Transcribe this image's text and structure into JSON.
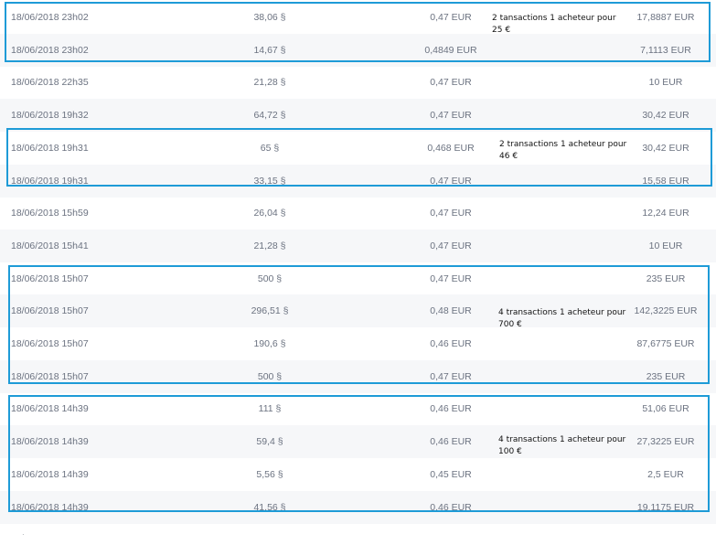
{
  "table": {
    "rows": [
      {
        "date": "18/06/2018 23h02",
        "amount": "38,06 §",
        "price": "0,47 EUR",
        "total": "17,8887 EUR"
      },
      {
        "date": "18/06/2018 23h02",
        "amount": "14,67 §",
        "price": "0,4849 EUR",
        "total": "7,1113 EUR"
      },
      {
        "date": "18/06/2018 22h35",
        "amount": "21,28 §",
        "price": "0,47 EUR",
        "total": "10 EUR"
      },
      {
        "date": "18/06/2018 19h32",
        "amount": "64,72 §",
        "price": "0,47 EUR",
        "total": "30,42 EUR"
      },
      {
        "date": "18/06/2018 19h31",
        "amount": "65 §",
        "price": "0,468 EUR",
        "total": "30,42 EUR"
      },
      {
        "date": "18/06/2018 19h31",
        "amount": "33,15 §",
        "price": "0,47 EUR",
        "total": "15,58 EUR"
      },
      {
        "date": "18/06/2018 15h59",
        "amount": "26,04 §",
        "price": "0,47 EUR",
        "total": "12,24 EUR"
      },
      {
        "date": "18/06/2018 15h41",
        "amount": "21,28 §",
        "price": "0,47 EUR",
        "total": "10 EUR"
      },
      {
        "date": "18/06/2018 15h07",
        "amount": "500 §",
        "price": "0,47 EUR",
        "total": "235 EUR"
      },
      {
        "date": "18/06/2018 15h07",
        "amount": "296,51 §",
        "price": "0,48 EUR",
        "total": "142,3225 EUR"
      },
      {
        "date": "18/06/2018 15h07",
        "amount": "190,6 §",
        "price": "0,46 EUR",
        "total": "87,6775 EUR"
      },
      {
        "date": "18/06/2018 15h07",
        "amount": "500 §",
        "price": "0,47 EUR",
        "total": "235 EUR"
      },
      {
        "date": "18/06/2018 14h39",
        "amount": "111 §",
        "price": "0,46 EUR",
        "total": "51,06 EUR"
      },
      {
        "date": "18/06/2018 14h39",
        "amount": "59,4 §",
        "price": "0,46 EUR",
        "total": "27,3225 EUR"
      },
      {
        "date": "18/06/2018 14h39",
        "amount": "5,56 §",
        "price": "0,45 EUR",
        "total": "2,5 EUR"
      },
      {
        "date": "18/06/2018 14h39",
        "amount": "41,56 §",
        "price": "0,46 EUR",
        "total": "19,1175 EUR"
      }
    ]
  },
  "annotations": [
    {
      "line1": "2 tansactions 1 acheteur pour",
      "line2": "25 €",
      "accent": "#1e9bd7"
    },
    {
      "line1": "2 transactions 1 acheteur pour",
      "line2": "46 €",
      "accent": "#1e9bd7"
    },
    {
      "line1": "4 transactions 1 acheteur pour",
      "line2": "700 €",
      "accent": "#1e9bd7"
    },
    {
      "line1": "4 transactions 1 acheteur pour",
      "line2": "100 €",
      "accent": "#1e9bd7"
    }
  ],
  "stray_mark": "·"
}
